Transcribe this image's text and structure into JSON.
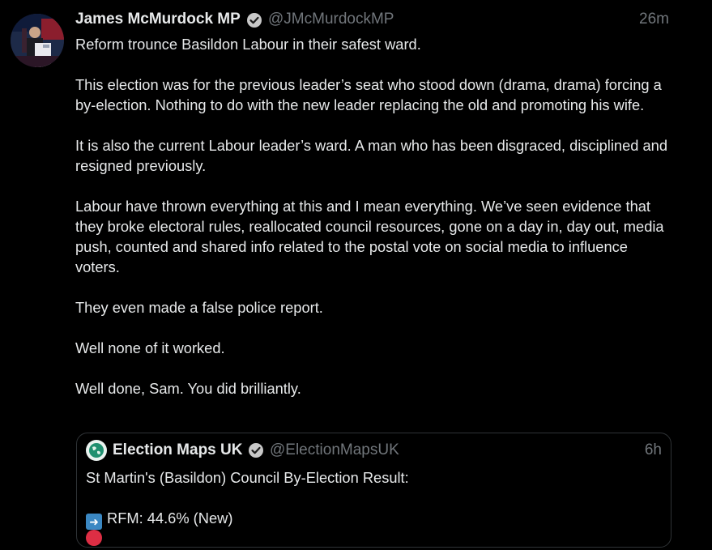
{
  "tweet": {
    "author_name": "James McMurdock MP",
    "handle": "@JMcMurdockMP",
    "time": "26m",
    "paragraphs": [
      "Reform trounce Basildon Labour in their safest ward.",
      "This election was for the previous leader’s seat who stood down (drama, drama) forcing a by-election. Nothing to do with the new leader replacing the old and promoting his wife.",
      "It is also the current Labour leader’s ward. A man who has been disgraced, disciplined and resigned previously.",
      "Labour have thrown everything at this and I mean everything. We’ve seen evidence that they broke electoral rules, reallocated council resources, gone on a day in, day out, media push, counted and shared info related to the postal vote on social media to influence voters.",
      "They even made a false police report.",
      "Well none of it worked.",
      "Well done, Sam. You did brilliantly."
    ]
  },
  "quoted": {
    "author_name": "Election Maps UK",
    "handle": "@ElectionMapsUK",
    "time": "6h",
    "title_line": "St Martin's (Basildon) Council By-Election Result:",
    "result_line": "RFM: 44.6% (New)"
  },
  "colors": {
    "background": "#000000",
    "text": "#e7e9ea",
    "muted": "#71767b",
    "border": "#2f3336"
  },
  "icons": {
    "verified": "verified-badge-icon",
    "arrow": "right-arrow-emoji-icon",
    "red_circle": "red-circle-emoji-icon"
  }
}
